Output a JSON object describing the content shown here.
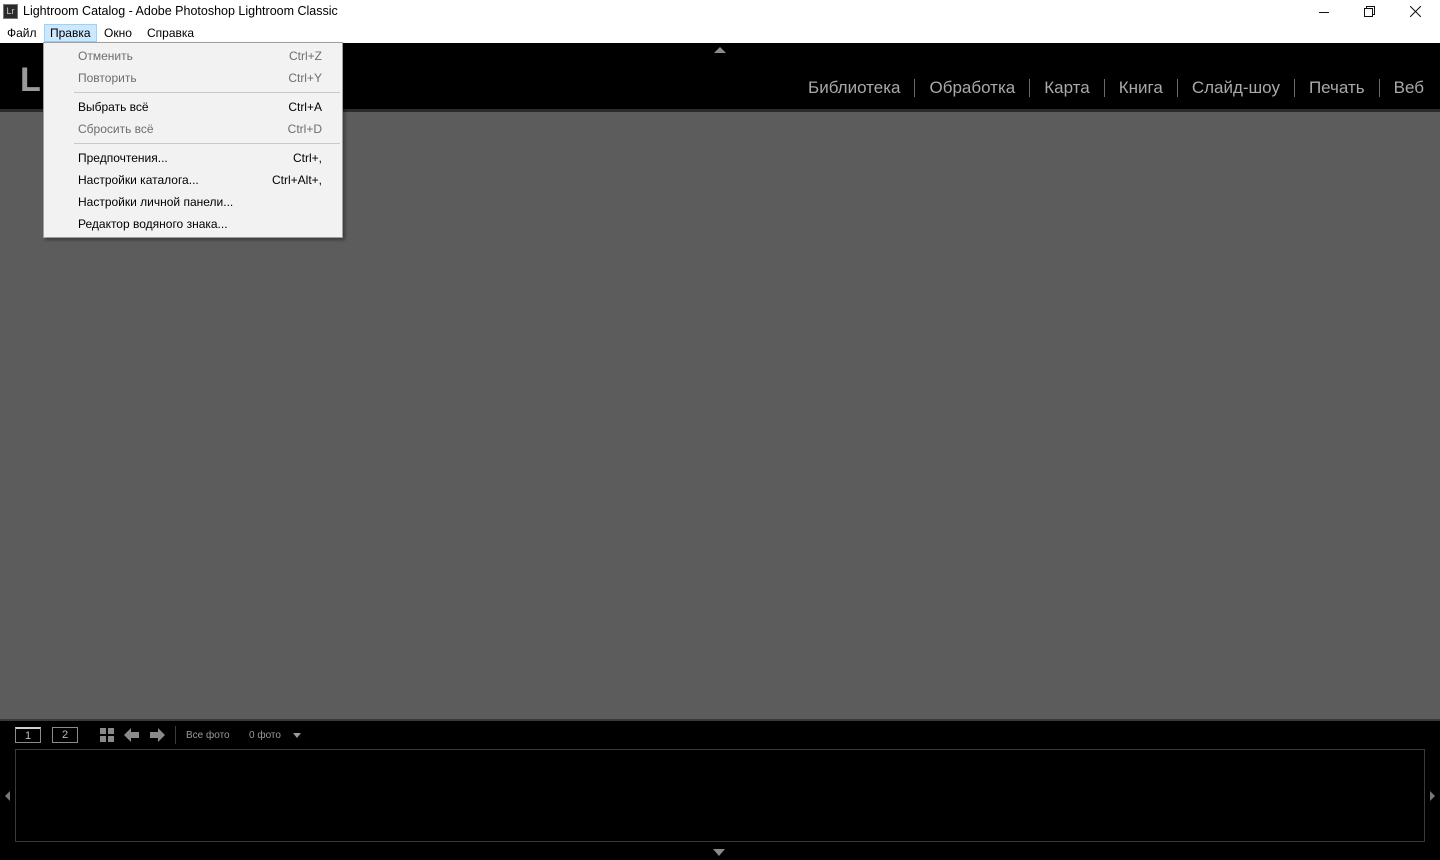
{
  "window": {
    "title": "Lightroom Catalog - Adobe Photoshop Lightroom Classic",
    "app_icon_text": "Lr",
    "controls": [
      "minimize-icon",
      "restore-icon",
      "close-icon"
    ]
  },
  "menubar": {
    "items": [
      {
        "label": "Файл",
        "active": false
      },
      {
        "label": "Правка",
        "active": true
      },
      {
        "label": "Окно",
        "active": false
      },
      {
        "label": "Справка",
        "active": false
      }
    ]
  },
  "edit_menu": {
    "items": [
      {
        "label": "Отменить",
        "shortcut": "Ctrl+Z",
        "enabled": false
      },
      {
        "label": "Повторить",
        "shortcut": "Ctrl+Y",
        "enabled": false
      },
      {
        "label": "Выбрать всё",
        "shortcut": "Ctrl+A",
        "enabled": true
      },
      {
        "label": "Сбросить всё",
        "shortcut": "Ctrl+D",
        "enabled": false
      },
      {
        "label": "Предпочтения...",
        "shortcut": "Ctrl+,",
        "enabled": true
      },
      {
        "label": "Настройки каталога...",
        "shortcut": "Ctrl+Alt+,",
        "enabled": true
      },
      {
        "label": "Настройки личной панели...",
        "shortcut": "",
        "enabled": true
      },
      {
        "label": "Редактор водяного знака...",
        "shortcut": "",
        "enabled": true
      }
    ]
  },
  "top_panel": {
    "logo": "Lr",
    "modules": [
      "Библиотека",
      "Обработка",
      "Карта",
      "Книга",
      "Слайд-шоу",
      "Печать",
      "Веб"
    ]
  },
  "filmstrip": {
    "screen_buttons": [
      "1",
      "2"
    ],
    "source_label": "Все фото",
    "count_label": "0 фото"
  },
  "colors": {
    "background": "#5c5c5c",
    "panel": "#000000",
    "menu_highlight": "#cce8ff",
    "module_text": "#a9a9a9"
  }
}
